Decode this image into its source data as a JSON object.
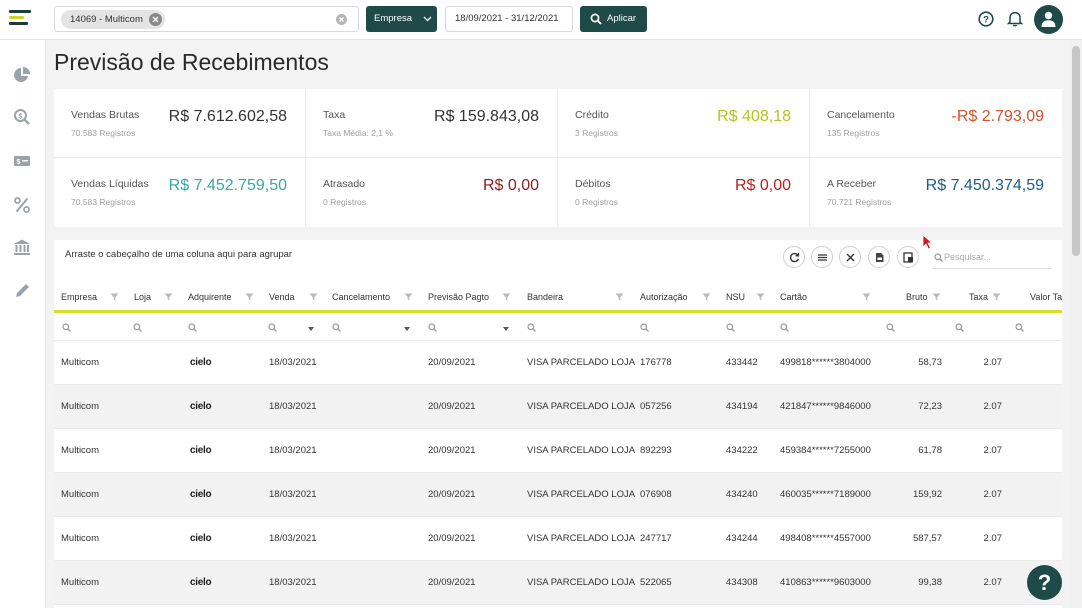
{
  "header": {
    "company_chip": "14069 - Multicom",
    "empresa_label": "Empresa",
    "date_range": "18/09/2021 - 31/12/2021",
    "apply_label": "Aplicar"
  },
  "page": {
    "title": "Previsão de Recebimentos"
  },
  "cards": [
    {
      "label": "Vendas Brutas",
      "sub": "70.583 Registros",
      "value": "R$ 7.612.602,58",
      "color": "#333333"
    },
    {
      "label": "Taxa",
      "sub": "Taxa Média: 2,1 %",
      "value": "R$ 159.843,08",
      "color": "#333333"
    },
    {
      "label": "Crédito",
      "sub": "3 Registros",
      "value": "R$ 408,18",
      "color": "#b5c41c"
    },
    {
      "label": "Cancelamento",
      "sub": "135 Registros",
      "value": "-R$ 2.793,09",
      "color": "#d0512b"
    },
    {
      "label": "Vendas Líquidas",
      "sub": "70.583 Registros",
      "value": "R$ 7.452.759,50",
      "color": "#3aa6a5"
    },
    {
      "label": "Atrasado",
      "sub": "0 Registros",
      "value": "R$ 0,00",
      "color": "#8a1f1f"
    },
    {
      "label": "Débitos",
      "sub": "0 Registros",
      "value": "R$ 0,00",
      "color": "#b3221e"
    },
    {
      "label": "A Receber",
      "sub": "70.721 Registros",
      "value": "R$ 7.450.374,59",
      "color": "#1e5c8a"
    }
  ],
  "grid": {
    "group_hint": "Arraste o cabeçalho de uma coluna aqui para agrupar",
    "search_placeholder": "Pesquisar...",
    "columns": [
      "Empresa",
      "Loja",
      "Adquirente",
      "Venda",
      "Cancelamento",
      "Previsão Pagto",
      "Bandeira",
      "Autorização",
      "NSU",
      "Cartão",
      "Bruto",
      "Taxa",
      "Valor Ta"
    ],
    "rows": [
      {
        "empresa": "Multicom",
        "adquirente": "cielo",
        "venda": "18/03/2021",
        "previsao": "20/09/2021",
        "bandeira": "VISA PARCELADO LOJA",
        "autorizacao": "176778",
        "nsu": "433442",
        "cartao": "499818******3804000",
        "bruto": "58,73",
        "taxa": "2.07"
      },
      {
        "empresa": "Multicom",
        "adquirente": "cielo",
        "venda": "18/03/2021",
        "previsao": "20/09/2021",
        "bandeira": "VISA PARCELADO LOJA",
        "autorizacao": "057256",
        "nsu": "434194",
        "cartao": "421847******9846000",
        "bruto": "72,23",
        "taxa": "2.07"
      },
      {
        "empresa": "Multicom",
        "adquirente": "cielo",
        "venda": "18/03/2021",
        "previsao": "20/09/2021",
        "bandeira": "VISA PARCELADO LOJA",
        "autorizacao": "892293",
        "nsu": "434222",
        "cartao": "459384******7255000",
        "bruto": "61,78",
        "taxa": "2.07"
      },
      {
        "empresa": "Multicom",
        "adquirente": "cielo",
        "venda": "18/03/2021",
        "previsao": "20/09/2021",
        "bandeira": "VISA PARCELADO LOJA",
        "autorizacao": "076908",
        "nsu": "434240",
        "cartao": "460035******7189000",
        "bruto": "159,92",
        "taxa": "2.07"
      },
      {
        "empresa": "Multicom",
        "adquirente": "cielo",
        "venda": "18/03/2021",
        "previsao": "20/09/2021",
        "bandeira": "VISA PARCELADO LOJA",
        "autorizacao": "247717",
        "nsu": "434244",
        "cartao": "498408******4557000",
        "bruto": "587,57",
        "taxa": "2.07"
      },
      {
        "empresa": "Multicom",
        "adquirente": "cielo",
        "venda": "18/03/2021",
        "previsao": "20/09/2021",
        "bandeira": "VISA PARCELADO LOJA",
        "autorizacao": "522065",
        "nsu": "434308",
        "cartao": "410863******9603000",
        "bruto": "99,38",
        "taxa": "2.07"
      }
    ]
  },
  "icons": {
    "sidebar": [
      "pie-chart-icon",
      "search-dollar-icon",
      "money-bill-icon",
      "percent-icon",
      "bank-icon",
      "pencil-icon"
    ],
    "toolbar": [
      "refresh-icon",
      "list-icon",
      "close-icon",
      "export-pdf-icon",
      "export-excel-icon"
    ]
  },
  "colors": {
    "brand": "#1e4a47",
    "accent": "#d6df2a"
  },
  "help_fab": "?"
}
